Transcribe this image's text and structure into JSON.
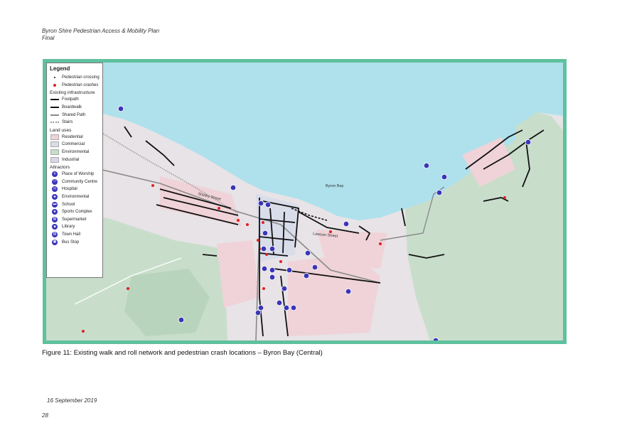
{
  "header": {
    "doc_title": "Byron Shire Pedestrian Access & Mobility Plan",
    "status": "Final"
  },
  "map": {
    "colors": {
      "frame": "#5fc19e",
      "sea": "#aee1ec",
      "land": "#e7e3e6",
      "environmental": "#c8decb",
      "residential": "#efd3d8",
      "commercial": "#d9dce9",
      "footpath": "#111111",
      "crash": "#e02020",
      "attractor": "#3b35b8"
    },
    "labels": {
      "place": "Byron Bay",
      "street_1": "Shirley Street",
      "street_2": "Lawson Street"
    },
    "legend": {
      "title": "Legend",
      "pedestrian_crossing": "Pedestrian crossing",
      "pedestrian_crashes": "Pedestrian crashes",
      "infra_heading": "Existing infrastructure",
      "infra": [
        {
          "label": "Footpath",
          "style": "solid"
        },
        {
          "label": "Boardwalk",
          "style": "dashed"
        },
        {
          "label": "Shared Path",
          "style": "grey"
        },
        {
          "label": "Stairs",
          "style": "dotted"
        }
      ],
      "landuse_heading": "Land uses",
      "landuses": [
        {
          "label": "Residential",
          "color": "#efd3d8"
        },
        {
          "label": "Commercial",
          "color": "#d9dce9"
        },
        {
          "label": "Environmental",
          "color": "#c8decb"
        },
        {
          "label": "Industrial",
          "color": "#dcd6ea"
        }
      ],
      "attractors_heading": "Attractors",
      "attractors": [
        {
          "label": "Place of Worship",
          "icon": "cross-icon",
          "glyph": "✝"
        },
        {
          "label": "Community Centre",
          "icon": "people-icon",
          "glyph": "⚇"
        },
        {
          "label": "Hospital",
          "icon": "hospital-icon",
          "glyph": "H"
        },
        {
          "label": "Environmental",
          "icon": "tree-icon",
          "glyph": "♣"
        },
        {
          "label": "School",
          "icon": "school-icon",
          "glyph": "▬"
        },
        {
          "label": "Sports Complex",
          "icon": "sports-icon",
          "glyph": "★"
        },
        {
          "label": "Supermarket",
          "icon": "cart-icon",
          "glyph": "▤"
        },
        {
          "label": "Library",
          "icon": "book-icon",
          "glyph": "■"
        },
        {
          "label": "Town Hall",
          "icon": "building-icon",
          "glyph": "▥"
        },
        {
          "label": "Bus Stop",
          "icon": "bus-icon",
          "glyph": "▣"
        }
      ]
    }
  },
  "caption": "Figure 11: Existing walk and roll network and pedestrian crash locations – Byron Bay (Central)",
  "footer": {
    "date": "16 September 2019",
    "page": "28"
  }
}
